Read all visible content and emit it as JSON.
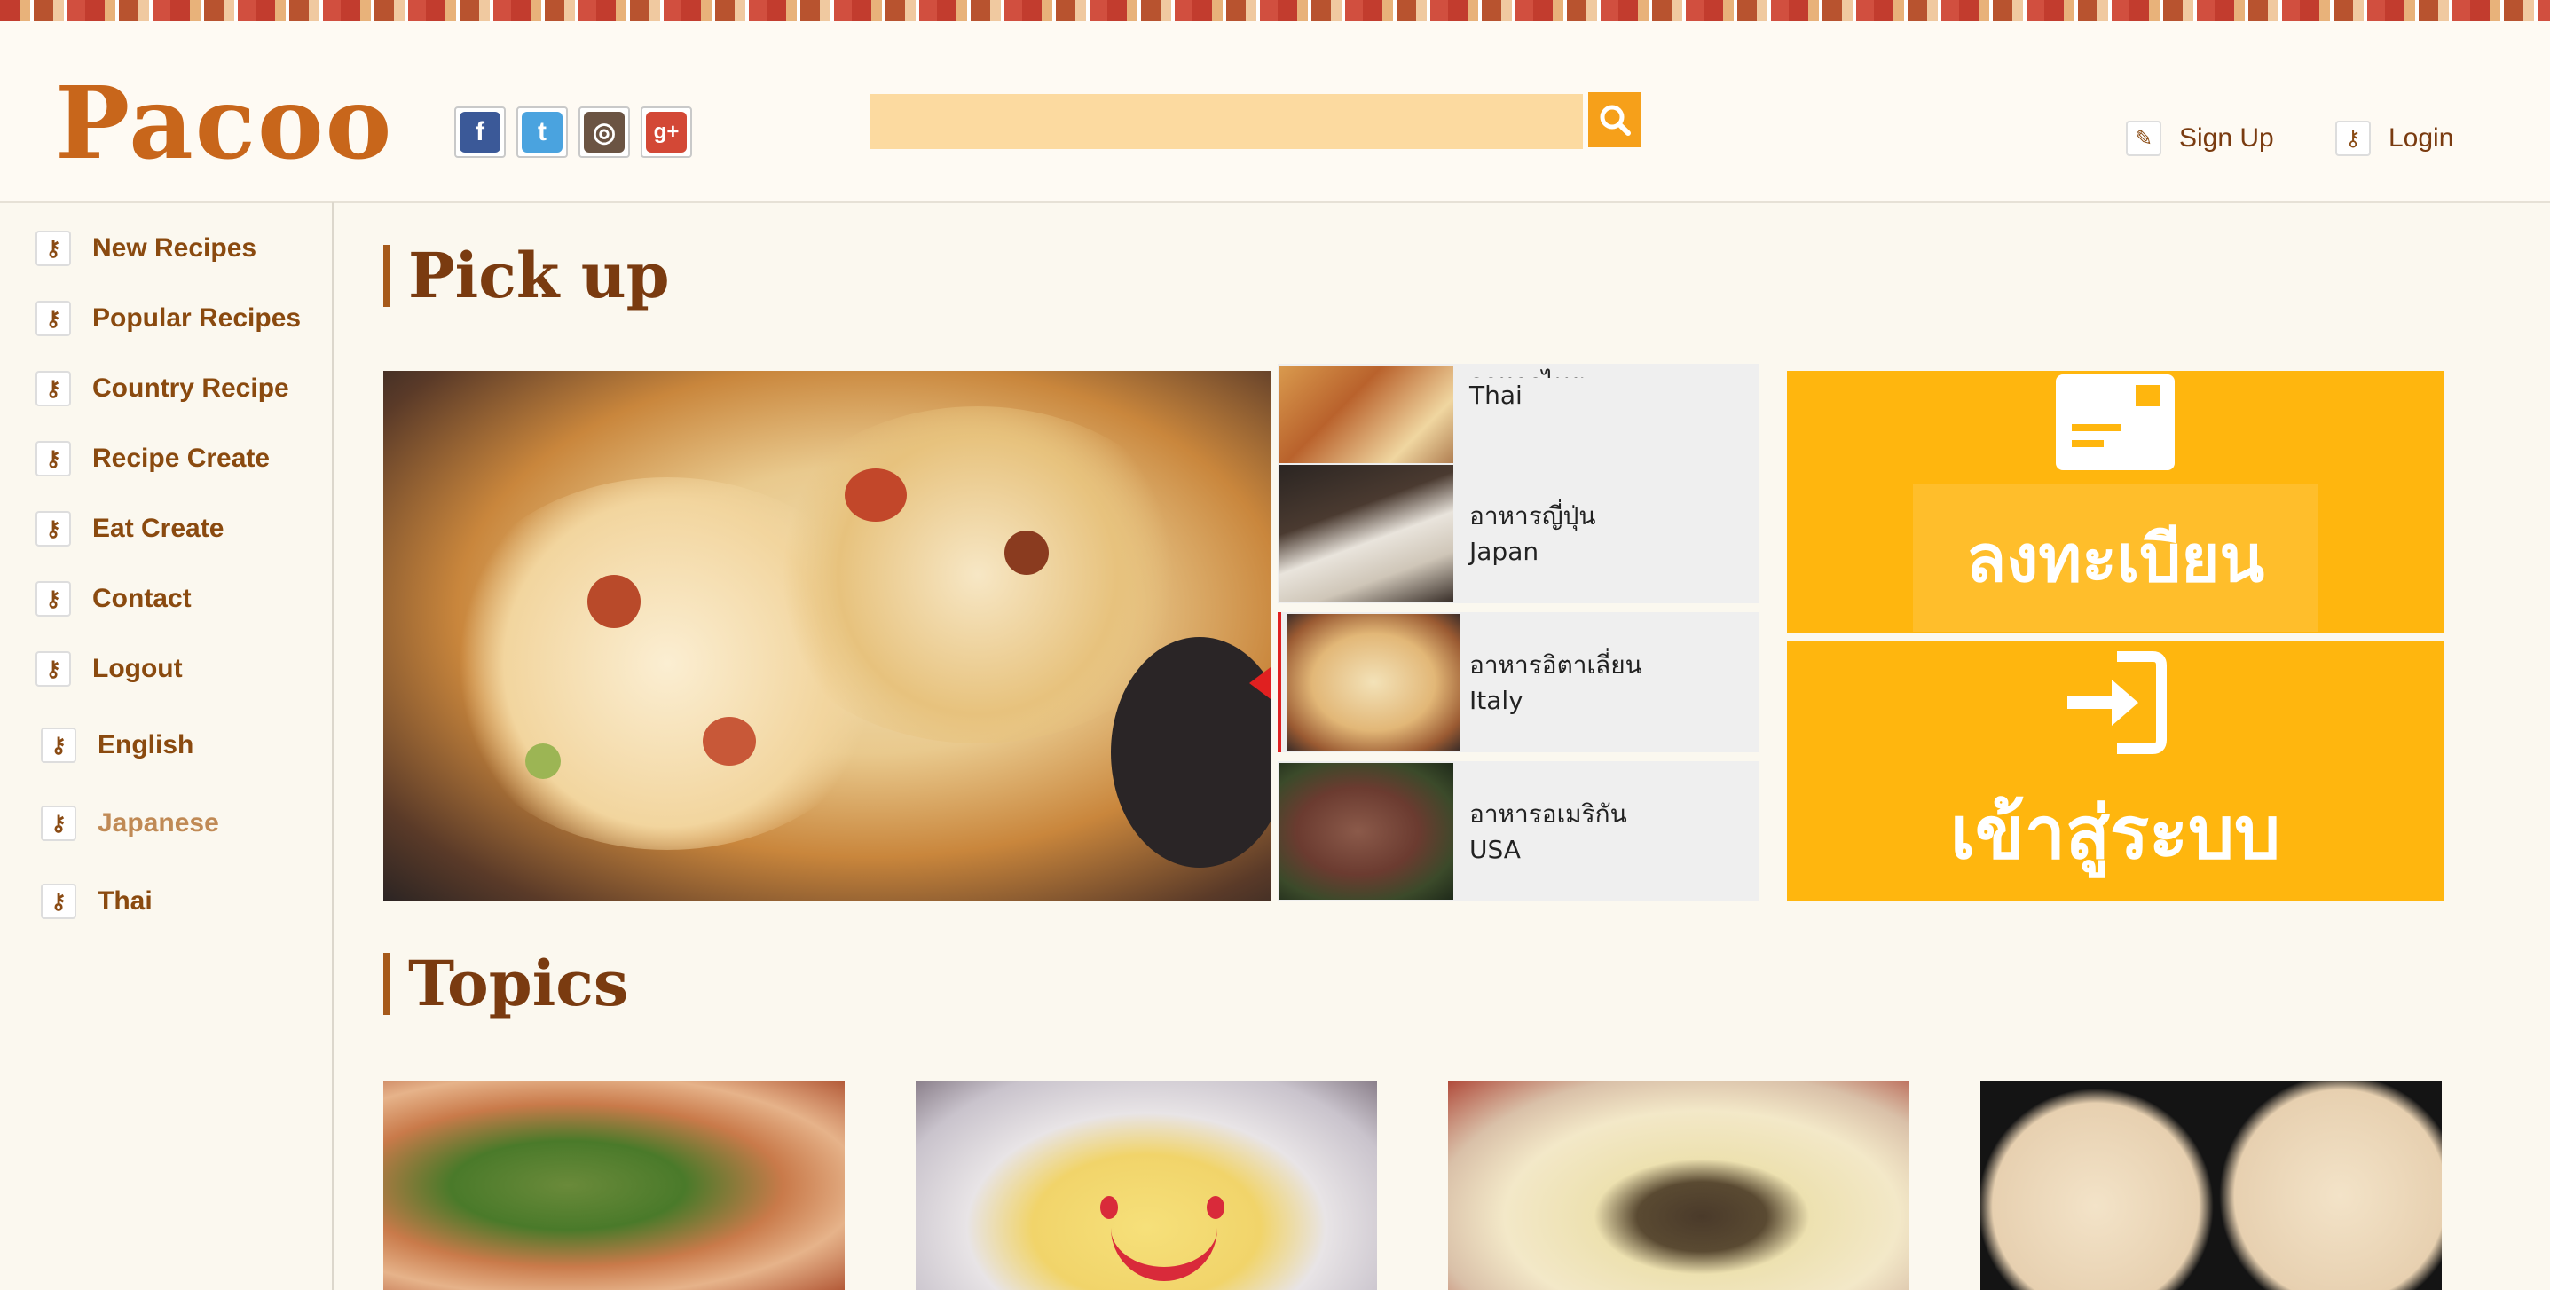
{
  "brand": {
    "logo_text": "Pacoo"
  },
  "social": [
    {
      "icon": "facebook-icon",
      "glyph": "f"
    },
    {
      "icon": "twitter-icon",
      "glyph": "t"
    },
    {
      "icon": "instagram-icon",
      "glyph": "◎"
    },
    {
      "icon": "google-plus-icon",
      "glyph": "g+"
    }
  ],
  "search": {
    "value": "",
    "placeholder": ""
  },
  "header_links": {
    "signup": "Sign Up",
    "login": "Login"
  },
  "sidebar": {
    "items": [
      {
        "label": "New Recipes"
      },
      {
        "label": "Popular Recipes"
      },
      {
        "label": "Country Recipe"
      },
      {
        "label": "Recipe Create"
      },
      {
        "label": "Eat Create"
      },
      {
        "label": "Contact"
      },
      {
        "label": "Logout"
      },
      {
        "label": "English"
      },
      {
        "label": "Japanese"
      },
      {
        "label": "Thai"
      }
    ]
  },
  "sections": {
    "pickup": "Pick up",
    "topics": "Topics"
  },
  "categories": [
    {
      "thai": "อาหารไทย",
      "en": "Thai"
    },
    {
      "thai": "อาหารญี่ปุ่น",
      "en": "Japan"
    },
    {
      "thai": "อาหารอิตาเลี่ยน",
      "en": "Italy"
    },
    {
      "thai": "อาหารอเมริกัน",
      "en": "USA"
    }
  ],
  "cta": {
    "register": "ลงทะเบียน",
    "login": "เข้าสู่ระบบ"
  },
  "colors": {
    "accent": "#ffb60e",
    "brand": "#c8661b",
    "active": "#e02020"
  }
}
